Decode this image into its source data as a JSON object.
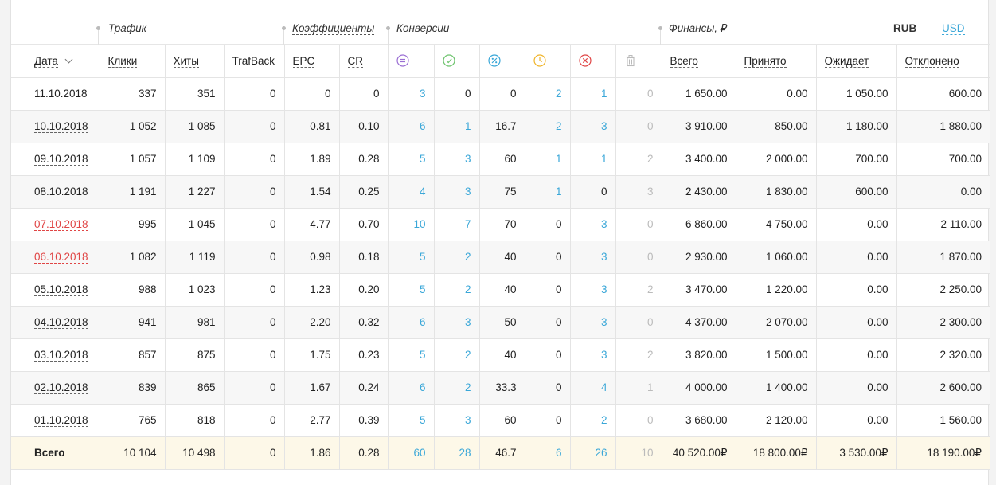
{
  "groups": {
    "traffic": "Трафик",
    "coefficients": "Коэффициенты",
    "conversions": "Конверсии",
    "finance": "Финансы, ₽"
  },
  "currency": {
    "active": "RUB",
    "alternative": "USD"
  },
  "columns": {
    "date": "Дата",
    "clicks": "Клики",
    "hits": "Хиты",
    "trafback": "TrafBack",
    "epc": "EPC",
    "cr": "CR",
    "total": "Всего",
    "accepted": "Принято",
    "pending": "Ожидает",
    "rejected": "Отклонено"
  },
  "conversion_icons": [
    {
      "name": "total-conversions-icon",
      "color": "#9b6fd4"
    },
    {
      "name": "approved-icon",
      "color": "#6cc36c"
    },
    {
      "name": "percent-icon",
      "color": "#3aa7d8"
    },
    {
      "name": "pending-clock-icon",
      "color": "#f0b429"
    },
    {
      "name": "rejected-icon",
      "color": "#e04545"
    },
    {
      "name": "trash-icon",
      "color": "#bbbbbb"
    }
  ],
  "rows": [
    {
      "date": "11.10.2018",
      "weekend": false,
      "clicks": "337",
      "hits": "351",
      "trafback": "0",
      "epc": "0",
      "cr": "0",
      "c1": "3",
      "c2": "0",
      "c3": "0",
      "c4": "2",
      "c5": "1",
      "c6": "0",
      "total": "1 650.00",
      "accepted": "0.00",
      "pending": "1 050.00",
      "rejected": "600.00"
    },
    {
      "date": "10.10.2018",
      "weekend": false,
      "clicks": "1 052",
      "hits": "1 085",
      "trafback": "0",
      "epc": "0.81",
      "cr": "0.10",
      "c1": "6",
      "c2": "1",
      "c3": "16.7",
      "c4": "2",
      "c5": "3",
      "c6": "0",
      "total": "3 910.00",
      "accepted": "850.00",
      "pending": "1 180.00",
      "rejected": "1 880.00"
    },
    {
      "date": "09.10.2018",
      "weekend": false,
      "clicks": "1 057",
      "hits": "1 109",
      "trafback": "0",
      "epc": "1.89",
      "cr": "0.28",
      "c1": "5",
      "c2": "3",
      "c3": "60",
      "c4": "1",
      "c5": "1",
      "c6": "2",
      "total": "3 400.00",
      "accepted": "2 000.00",
      "pending": "700.00",
      "rejected": "700.00"
    },
    {
      "date": "08.10.2018",
      "weekend": false,
      "clicks": "1 191",
      "hits": "1 227",
      "trafback": "0",
      "epc": "1.54",
      "cr": "0.25",
      "c1": "4",
      "c2": "3",
      "c3": "75",
      "c4": "1",
      "c5": "0",
      "c6": "3",
      "total": "2 430.00",
      "accepted": "1 830.00",
      "pending": "600.00",
      "rejected": "0.00"
    },
    {
      "date": "07.10.2018",
      "weekend": true,
      "clicks": "995",
      "hits": "1 045",
      "trafback": "0",
      "epc": "4.77",
      "cr": "0.70",
      "c1": "10",
      "c2": "7",
      "c3": "70",
      "c4": "0",
      "c5": "3",
      "c6": "0",
      "total": "6 860.00",
      "accepted": "4 750.00",
      "pending": "0.00",
      "rejected": "2 110.00"
    },
    {
      "date": "06.10.2018",
      "weekend": true,
      "clicks": "1 082",
      "hits": "1 119",
      "trafback": "0",
      "epc": "0.98",
      "cr": "0.18",
      "c1": "5",
      "c2": "2",
      "c3": "40",
      "c4": "0",
      "c5": "3",
      "c6": "0",
      "total": "2 930.00",
      "accepted": "1 060.00",
      "pending": "0.00",
      "rejected": "1 870.00"
    },
    {
      "date": "05.10.2018",
      "weekend": false,
      "clicks": "988",
      "hits": "1 023",
      "trafback": "0",
      "epc": "1.23",
      "cr": "0.20",
      "c1": "5",
      "c2": "2",
      "c3": "40",
      "c4": "0",
      "c5": "3",
      "c6": "2",
      "total": "3 470.00",
      "accepted": "1 220.00",
      "pending": "0.00",
      "rejected": "2 250.00"
    },
    {
      "date": "04.10.2018",
      "weekend": false,
      "clicks": "941",
      "hits": "981",
      "trafback": "0",
      "epc": "2.20",
      "cr": "0.32",
      "c1": "6",
      "c2": "3",
      "c3": "50",
      "c4": "0",
      "c5": "3",
      "c6": "0",
      "total": "4 370.00",
      "accepted": "2 070.00",
      "pending": "0.00",
      "rejected": "2 300.00"
    },
    {
      "date": "03.10.2018",
      "weekend": false,
      "clicks": "857",
      "hits": "875",
      "trafback": "0",
      "epc": "1.75",
      "cr": "0.23",
      "c1": "5",
      "c2": "2",
      "c3": "40",
      "c4": "0",
      "c5": "3",
      "c6": "2",
      "total": "3 820.00",
      "accepted": "1 500.00",
      "pending": "0.00",
      "rejected": "2 320.00"
    },
    {
      "date": "02.10.2018",
      "weekend": false,
      "clicks": "839",
      "hits": "865",
      "trafback": "0",
      "epc": "1.67",
      "cr": "0.24",
      "c1": "6",
      "c2": "2",
      "c3": "33.3",
      "c4": "0",
      "c5": "4",
      "c6": "1",
      "total": "4 000.00",
      "accepted": "1 400.00",
      "pending": "0.00",
      "rejected": "2 600.00"
    },
    {
      "date": "01.10.2018",
      "weekend": false,
      "clicks": "765",
      "hits": "818",
      "trafback": "0",
      "epc": "2.77",
      "cr": "0.39",
      "c1": "5",
      "c2": "3",
      "c3": "60",
      "c4": "0",
      "c5": "2",
      "c6": "0",
      "total": "3 680.00",
      "accepted": "2 120.00",
      "pending": "0.00",
      "rejected": "1 560.00"
    }
  ],
  "totals": {
    "label": "Всего",
    "clicks": "10 104",
    "hits": "10 498",
    "trafback": "0",
    "epc": "1.86",
    "cr": "0.28",
    "c1": "60",
    "c2": "28",
    "c3": "46.7",
    "c4": "6",
    "c5": "26",
    "c6": "10",
    "total": "40 520.00₽",
    "accepted": "18 800.00₽",
    "pending": "3 530.00₽",
    "rejected": "18 190.00₽"
  }
}
